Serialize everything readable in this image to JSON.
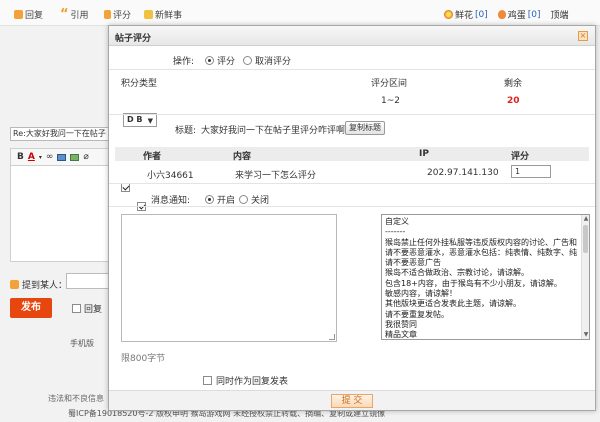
{
  "background": {
    "toolbar": {
      "reply": "回复",
      "quote": "引用",
      "rate": "评分",
      "new_news": "新鲜事",
      "flower": "鲜花",
      "flower_count": "[0]",
      "egg": "鸡蛋",
      "egg_count": "[0]",
      "top": "顶端"
    },
    "reply_title": "Re:大家好我问一下在帖子",
    "mention_label": "提到某人：",
    "submit_label": "发布",
    "reply_check_label": "回复",
    "mobile_link": "手机版",
    "footer_line1": "违法和不良信息",
    "footer_line2": "蜀ICP备19018520号-2 版权申明 猴岛游戏网 未经授权禁止转载、摘编、复制或建立镜像"
  },
  "modal": {
    "title": "帖子评分",
    "operation_label": "操作:",
    "operation_rate": "评分",
    "operation_cancel": "取消评分",
    "score_type_header": "积分类型",
    "score_range_header": "评分区间",
    "remaining_header": "剩余",
    "score_type_value": "D B",
    "score_range_value": "1~2",
    "remaining_value": "20",
    "subject_label": "标题:",
    "subject_value": "大家好我问一下在帖子里评分咋评啊",
    "copy_button": "复制标题",
    "table_headers": {
      "author": "作者",
      "content": "内容",
      "ip": "IP",
      "score": "评分"
    },
    "row": {
      "author": "小六34661",
      "content": "来学习一下怎么评分",
      "ip": "202.97.141.130",
      "score": "1"
    },
    "notify_label": "消息通知:",
    "notify_on": "开启",
    "notify_off": "关闭",
    "char_limit": "限800字节",
    "reasons": [
      "自定义",
      "-------",
      "猴岛禁止任何外挂私服等违反版权内容的讨论、广告和",
      "请不要恶意灌水，恶意灌水包括：纯表情、纯数字、纯",
      "请不要恶意广告",
      "猴岛不适合做政治、宗教讨论，请谅解。",
      "包含18+内容，由于猴岛有不少小朋友，请谅解。",
      "敏感内容，请谅解！",
      "其他版块更适合发表此主题，请谅解。",
      "请不要重复发帖。",
      "我很赞同",
      "精品文章"
    ],
    "reply_also_label": "同时作为回复发表",
    "submit": "提 交"
  }
}
